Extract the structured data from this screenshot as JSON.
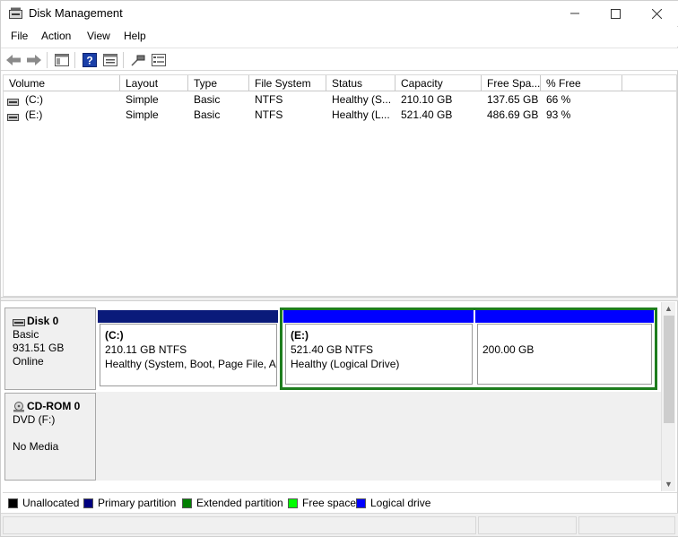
{
  "window": {
    "title": "Disk Management"
  },
  "menu": [
    "File",
    "Action",
    "View",
    "Help"
  ],
  "toolbar": {
    "buttons": [
      "back-arrow-icon",
      "forward-arrow-icon",
      "console-tree-icon",
      "help-icon",
      "properties-icon",
      "connect-icon",
      "list-view-icon"
    ]
  },
  "volume_list": {
    "columns": [
      "Volume",
      "Layout",
      "Type",
      "File System",
      "Status",
      "Capacity",
      "Free Spa...",
      "% Free"
    ],
    "rows": [
      {
        "volume": "(C:)",
        "layout": "Simple",
        "type": "Basic",
        "fs": "NTFS",
        "status": "Healthy (S...",
        "capacity": "210.10 GB",
        "free": "137.65 GB",
        "pct": "66 %"
      },
      {
        "volume": "(E:)",
        "layout": "Simple",
        "type": "Basic",
        "fs": "NTFS",
        "status": "Healthy (L...",
        "capacity": "521.40 GB",
        "free": "486.69 GB",
        "pct": "93 %"
      }
    ]
  },
  "disks": [
    {
      "name": "Disk 0",
      "type": "Basic",
      "size": "931.51 GB",
      "state": "Online",
      "partitions": [
        {
          "name": "(C:)",
          "size": "210.11 GB NTFS",
          "status": "Healthy (System, Boot, Page File, Ac"
        },
        {
          "name": "(E:)",
          "size": "521.40 GB NTFS",
          "status": "Healthy (Logical Drive)"
        },
        {
          "name": "",
          "size": "200.00 GB",
          "status": ""
        }
      ]
    },
    {
      "name": "CD-ROM 0",
      "type": "DVD (F:)",
      "size": "",
      "state": "No Media"
    }
  ],
  "legend": [
    {
      "label": "Unallocated",
      "color": "#000000"
    },
    {
      "label": "Primary partition",
      "color": "#00007f"
    },
    {
      "label": "Extended partition",
      "color": "#007f00"
    },
    {
      "label": "Free space",
      "color": "#00ff00"
    },
    {
      "label": "Logical drive",
      "color": "#0000ff"
    }
  ],
  "colors": {
    "primary_bar": "#0a1a7a",
    "logical_bar": "#0000ff",
    "extended_frame": "#1e7d1e"
  }
}
